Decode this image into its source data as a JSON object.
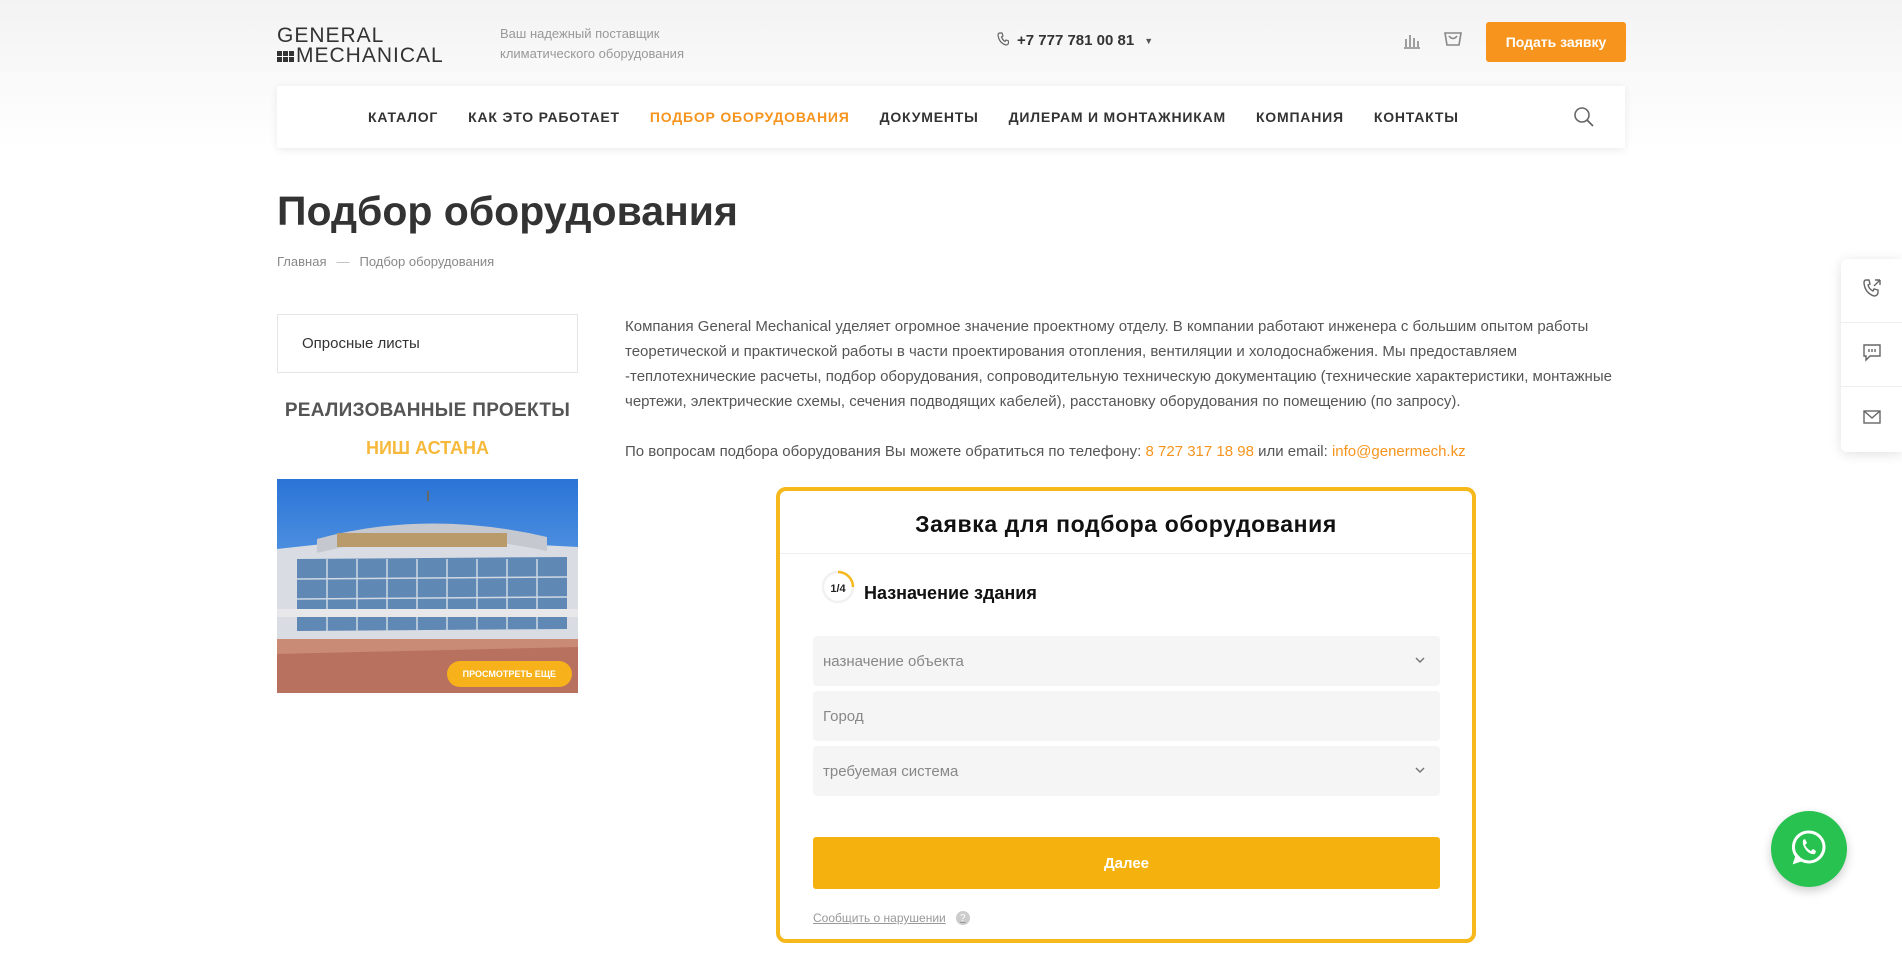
{
  "header": {
    "logo_line1": "GENERAL",
    "logo_line2": "MECHANICAL",
    "tagline_line1": "Ваш надежный поставщик",
    "tagline_line2": "климатического оборудования",
    "phone": "+7 777 781 00 81",
    "request_button": "Подать заявку"
  },
  "nav": {
    "items": [
      {
        "label": "КАТАЛОГ"
      },
      {
        "label": "КАК ЭТО РАБОТАЕТ"
      },
      {
        "label": "ПОДБОР ОБОРУДОВАНИЯ"
      },
      {
        "label": "ДОКУМЕНТЫ"
      },
      {
        "label": "ДИЛЕРАМ И МОНТАЖНИКАМ"
      },
      {
        "label": "КОМПАНИЯ"
      },
      {
        "label": "КОНТАКТЫ"
      }
    ],
    "active_index": 2
  },
  "page": {
    "title": "Подбор оборудования",
    "breadcrumb": {
      "home": "Главная",
      "separator": "—",
      "current": "Подбор оборудования"
    }
  },
  "sidebar": {
    "menu_item": "Опросные листы",
    "promo_title": "РЕАЛИЗОВАННЫЕ ПРОЕКТЫ",
    "promo_subtitle": "НИШ АСТАНА",
    "promo_button": "ПРОСМОТРЕТЬ ЕЩЕ"
  },
  "content": {
    "paragraph1": "Компания General Mechanical уделяет огромное значение проектному отделу. В компании работают инженера с большим опытом работы теоретической и практической работы в части проектирования отопления, вентиляции и холодоснабжения. Мы предоставляем -теплотехнические расчеты, подбор оборудования, сопроводительную техническую документацию (технические характеристики, монтажные чертежи, электрические схемы, сечения подводящих кабелей), расстановку оборудования по помещению (по запросу).",
    "contact_prefix": "По вопросам подбора оборудования Вы можете обратиться по телефону: ",
    "contact_phone": "8 727 317 18 98",
    "contact_middle": " или email: ",
    "contact_email": "info@genermech.kz"
  },
  "form": {
    "title": "Заявка для подбора оборудования",
    "step": "1/4",
    "step_progress": 0.25,
    "step_label": "Назначение здания",
    "field_purpose_placeholder": "назначение объекта",
    "field_city_placeholder": "Город",
    "field_system_placeholder": "требуемая система",
    "next_button": "Далее",
    "report_link": "Сообщить о нарушении",
    "help_icon": "?"
  },
  "colors": {
    "accent_orange": "#f7941d",
    "accent_yellow": "#f5b20f",
    "whatsapp_green": "#28c251"
  }
}
